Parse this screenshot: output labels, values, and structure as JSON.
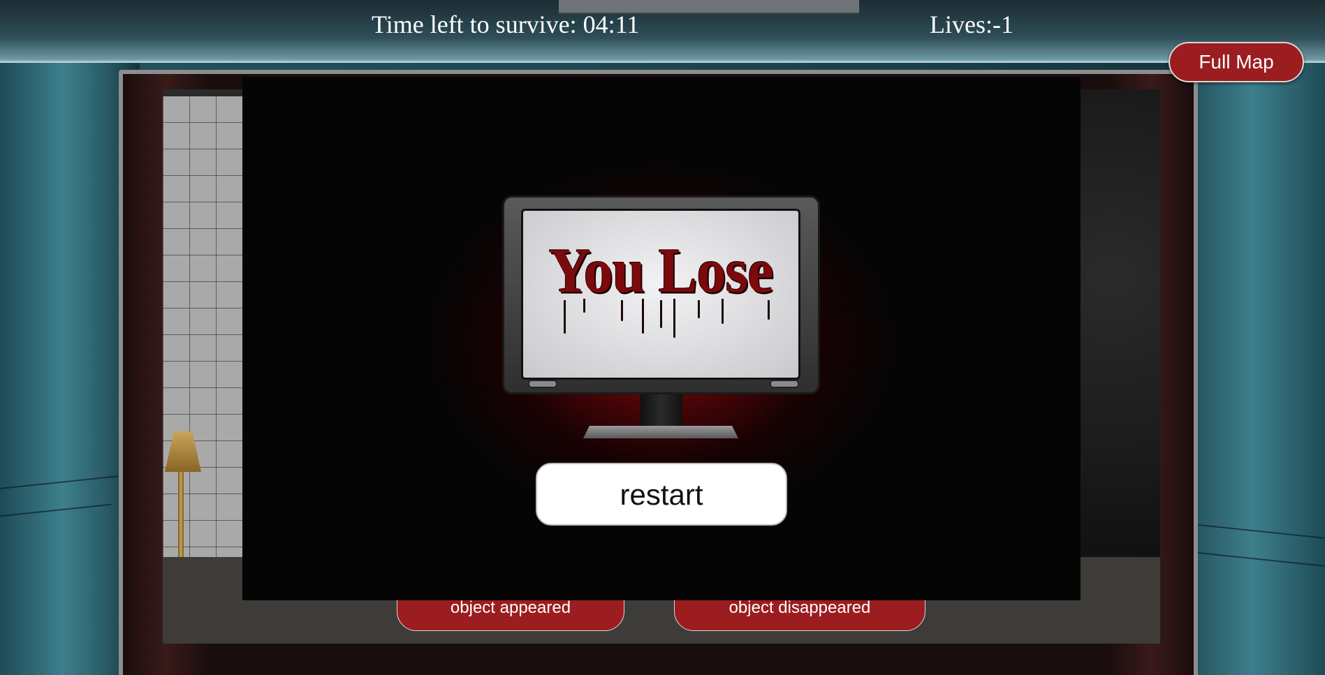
{
  "hud": {
    "timer_text": "Time left to survive: 04:11",
    "lives_text": "Lives:-1"
  },
  "map": {
    "full_map_label": "Full Map"
  },
  "game": {
    "appeared_label": "object appeared",
    "disappeared_label": "object disappeared"
  },
  "lose_screen": {
    "title": "You Lose",
    "restart_label": "restart"
  },
  "colors": {
    "button_red": "#9c1d20",
    "blood_red": "#7b0a0d",
    "wall_teal": "#3d7f8c"
  }
}
